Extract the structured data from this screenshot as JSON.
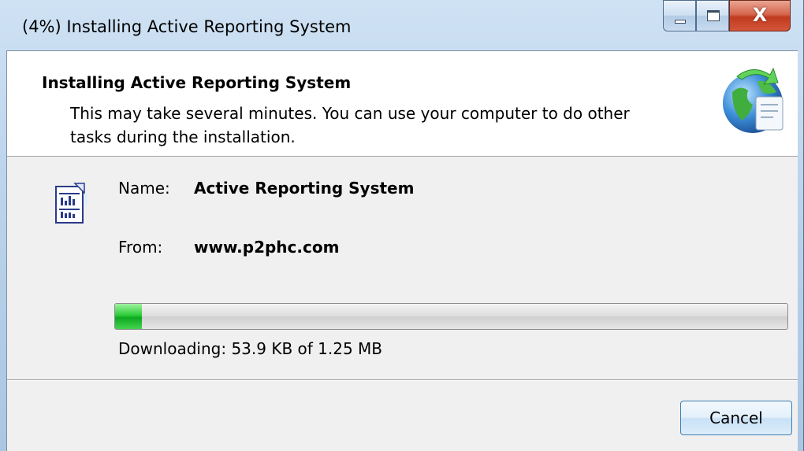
{
  "window": {
    "title": "(4%) Installing Active Reporting System",
    "close_glyph": "X"
  },
  "header": {
    "title": "Installing Active Reporting System",
    "description": "This may take several minutes. You can use your computer to do other tasks during the installation."
  },
  "details": {
    "name_label": "Name:",
    "name_value": "Active Reporting System",
    "from_label": "From:",
    "from_value": "www.p2phc.com"
  },
  "progress": {
    "fraction": 0.04,
    "status": "Downloading: 53.9 KB of 1.25 MB"
  },
  "buttons": {
    "cancel": "Cancel"
  },
  "icons": {
    "header": "globe-install-icon",
    "application": "report-document-icon"
  },
  "colors": {
    "progress_fill": "#16b02a",
    "close_button": "#c8452b"
  }
}
